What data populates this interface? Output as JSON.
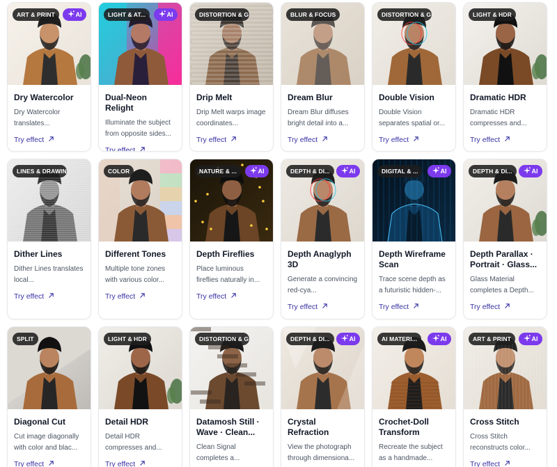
{
  "try_label": "Try effect",
  "ai_label": "AI",
  "accent": "#7c3aed",
  "link_color": "#3730a3",
  "cards": [
    {
      "tag": "ART & PRINT",
      "ai": true,
      "title": "Dry Watercolor",
      "desc": "Dry Watercolor translates...",
      "style": "watercolor"
    },
    {
      "tag": "LIGHT & AT...",
      "ai": true,
      "title": "Dual-Neon Relight",
      "desc": "Illuminate the subject from opposite sides...",
      "style": "neon"
    },
    {
      "tag": "DISTORTION & GLITCH",
      "ai": false,
      "title": "Drip Melt",
      "desc": "Drip Melt warps image coordinates...",
      "style": "melt"
    },
    {
      "tag": "BLUR & FOCUS",
      "ai": false,
      "title": "Dream Blur",
      "desc": "Dream Blur diffuses bright detail into a...",
      "style": "blur"
    },
    {
      "tag": "DISTORTION & GLITCH",
      "ai": false,
      "title": "Double Vision",
      "desc": "Double Vision separates spatial or...",
      "style": "double"
    },
    {
      "tag": "LIGHT & HDR",
      "ai": false,
      "title": "Dramatic HDR",
      "desc": "Dramatic HDR compresses and...",
      "style": "hdr"
    },
    {
      "tag": "LINES & DRAWING",
      "ai": false,
      "title": "Dither Lines",
      "desc": "Dither Lines translates local...",
      "style": "lines"
    },
    {
      "tag": "COLOR",
      "ai": false,
      "title": "Different Tones",
      "desc": "Multiple tone zones with various color...",
      "style": "tones"
    },
    {
      "tag": "NATURE & ...",
      "ai": true,
      "title": "Depth Fireflies",
      "desc": "Place luminous fireflies naturally in...",
      "style": "fireflies"
    },
    {
      "tag": "DEPTH & DI...",
      "ai": true,
      "title": "Depth Anaglyph 3D",
      "desc": "Generate a convincing red-cya...",
      "style": "anaglyph"
    },
    {
      "tag": "DIGITAL & ...",
      "ai": true,
      "title": "Depth Wireframe Scan",
      "desc": "Trace scene depth as a futuristic hidden-...",
      "style": "wireframe"
    },
    {
      "tag": "DEPTH & DI...",
      "ai": true,
      "title": "Depth Parallax · Portrait · Glass...",
      "desc": "Glass Material completes a Depth...",
      "style": "parallax"
    },
    {
      "tag": "SPLIT",
      "ai": false,
      "title": "Diagonal Cut",
      "desc": "Cut image diagonally with color and blac...",
      "style": "diagonal"
    },
    {
      "tag": "LIGHT & HDR",
      "ai": false,
      "title": "Detail HDR",
      "desc": "Detail HDR compresses and...",
      "style": "hdr2"
    },
    {
      "tag": "DISTORTION & GLITCH",
      "ai": false,
      "title": "Datamosh Still · Wave · Clean...",
      "desc": "Clean Signal completes a...",
      "style": "datamosh"
    },
    {
      "tag": "DEPTH & DI...",
      "ai": true,
      "title": "Crystal Refraction",
      "desc": "View the photograph through dimensiona...",
      "style": "crystal"
    },
    {
      "tag": "AI MATERI...",
      "ai": true,
      "title": "Crochet-Doll Transform",
      "desc": "Recreate the subject as a handmade...",
      "style": "crochet"
    },
    {
      "tag": "ART & PRINT",
      "ai": true,
      "title": "Cross Stitch",
      "desc": "Cross Stitch reconstructs color...",
      "style": "stitch"
    }
  ]
}
